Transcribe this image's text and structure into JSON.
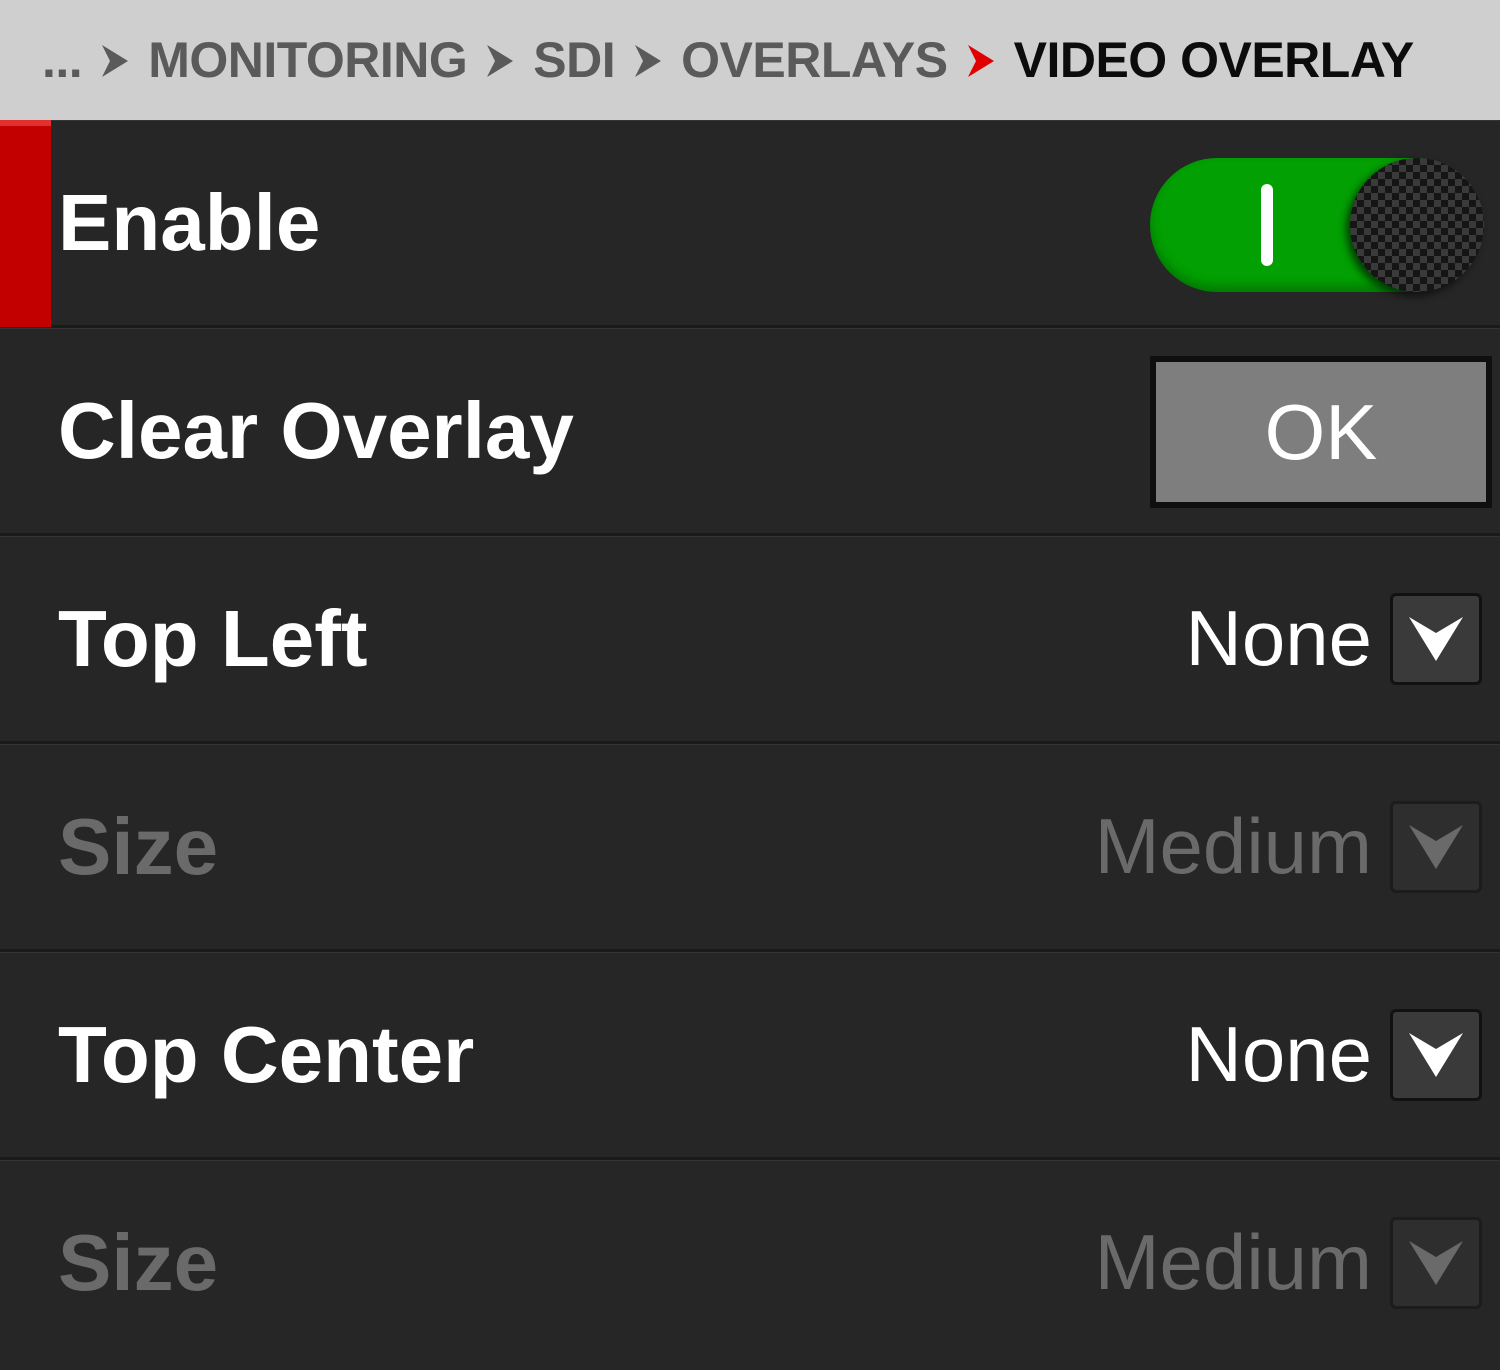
{
  "breadcrumb": {
    "items": [
      {
        "label": "..."
      },
      {
        "label": "MONITORING"
      },
      {
        "label": "SDI"
      },
      {
        "label": "OVERLAYS"
      },
      {
        "label": "VIDEO OVERLAY"
      }
    ],
    "separator_icon": "chevron-right-icon",
    "active_separator_color": "#e00000"
  },
  "menu": {
    "rows": [
      {
        "label": "Enable",
        "control": "toggle",
        "state": "on",
        "selected": true
      },
      {
        "label": "Clear Overlay",
        "control": "button",
        "button_label": "OK"
      },
      {
        "label": "Top Left",
        "control": "dropdown",
        "value": "None",
        "enabled": true
      },
      {
        "label": "Size",
        "control": "dropdown",
        "value": "Medium",
        "enabled": false
      },
      {
        "label": "Top Center",
        "control": "dropdown",
        "value": "None",
        "enabled": true
      },
      {
        "label": "Size",
        "control": "dropdown",
        "value": "Medium",
        "enabled": false
      }
    ]
  },
  "colors": {
    "selection_accent": "#c20000",
    "toggle_on": "#02a002",
    "background": "#262626",
    "header_bg": "#cfcfcf"
  }
}
